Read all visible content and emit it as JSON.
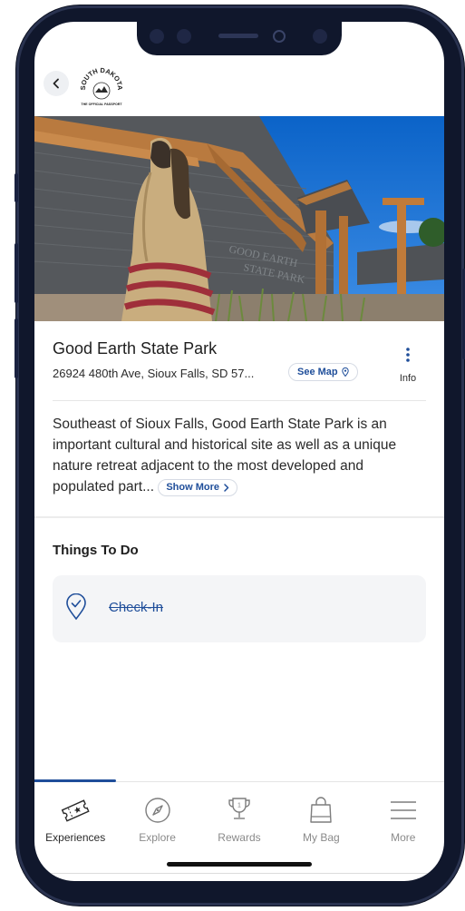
{
  "header": {
    "back_label": "Back",
    "logo": {
      "line1": "SOUTH DAKOTA",
      "line2": "THE OFFICIAL PASSPORT"
    }
  },
  "hero": {
    "sign_text": [
      "GOOD EARTH",
      "STATE PARK"
    ]
  },
  "place": {
    "title": "Good Earth State Park",
    "address": "26924 480th Ave, Sioux Falls, SD 57...",
    "see_map_label": "See Map",
    "info_label": "Info"
  },
  "description": {
    "text": "Southeast of Sioux Falls, Good Earth State Park is an important cultural and historical site as well as a unique nature retreat adjacent to the most developed and populated part...",
    "show_more_label": "Show More"
  },
  "things_to_do": {
    "title": "Things To Do",
    "items": [
      {
        "label": "Check-In",
        "completed": true
      }
    ]
  },
  "bottom_nav": {
    "items": [
      {
        "label": "Experiences",
        "icon": "ticket-icon",
        "active": true
      },
      {
        "label": "Explore",
        "icon": "compass-icon",
        "active": false
      },
      {
        "label": "Rewards",
        "icon": "trophy-icon",
        "active": false
      },
      {
        "label": "My Bag",
        "icon": "bag-icon",
        "active": false
      },
      {
        "label": "More",
        "icon": "menu-icon",
        "active": false
      }
    ]
  },
  "colors": {
    "accent": "#1f4e9a",
    "frame": "#10172c",
    "card_bg": "#f4f5f7",
    "text": "#1e1e1e",
    "muted": "#8a8a8a"
  }
}
